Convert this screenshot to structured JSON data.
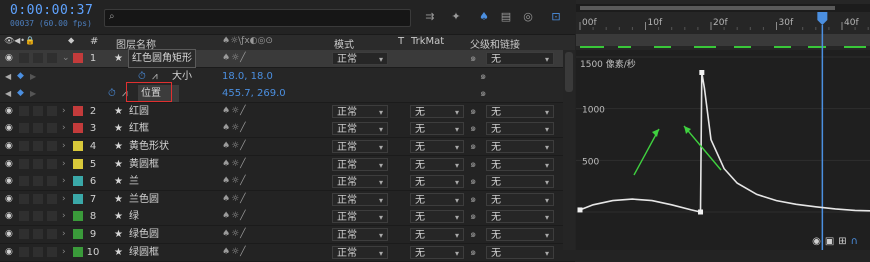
{
  "header": {
    "timecode": "0:00:00:37",
    "framecode": "00037 (60.00 fps)",
    "search_placeholder": "",
    "search_icon": "search-icon"
  },
  "columns": {
    "layer_name": "图层名称",
    "mode": "模式",
    "t": "T",
    "trkmat": "TrkMat",
    "parent": "父级和链接"
  },
  "layers": [
    {
      "num": "1",
      "name": "红色圆角矩形",
      "color": "#c33b3b",
      "mode": "正常",
      "trkmat": "",
      "parent": "无",
      "expanded": true,
      "selected": true
    },
    {
      "num": "2",
      "name": "红圆",
      "color": "#c33b3b",
      "mode": "正常",
      "trkmat": "无",
      "parent": "无"
    },
    {
      "num": "3",
      "name": "红框",
      "color": "#c33b3b",
      "mode": "正常",
      "trkmat": "无",
      "parent": "无"
    },
    {
      "num": "4",
      "name": "黄色形状",
      "color": "#d9c93a",
      "mode": "正常",
      "trkmat": "无",
      "parent": "无"
    },
    {
      "num": "5",
      "name": "黄圆框",
      "color": "#d9c93a",
      "mode": "正常",
      "trkmat": "无",
      "parent": "无"
    },
    {
      "num": "6",
      "name": "兰",
      "color": "#3aa8a8",
      "mode": "正常",
      "trkmat": "无",
      "parent": "无"
    },
    {
      "num": "7",
      "name": "兰色圆",
      "color": "#3aa8a8",
      "mode": "正常",
      "trkmat": "无",
      "parent": "无"
    },
    {
      "num": "8",
      "name": "绿",
      "color": "#3a9a3a",
      "mode": "正常",
      "trkmat": "无",
      "parent": "无"
    },
    {
      "num": "9",
      "name": "绿色圆",
      "color": "#3a9a3a",
      "mode": "正常",
      "trkmat": "无",
      "parent": "无"
    },
    {
      "num": "10",
      "name": "绿圆框",
      "color": "#3a9a3a",
      "mode": "正常",
      "trkmat": "无",
      "parent": "无"
    }
  ],
  "properties": [
    {
      "name": "大小",
      "value": "18.0, 18.0"
    },
    {
      "name": "位置",
      "value": "455.7, 269.0"
    }
  ],
  "ruler": {
    "ticks": [
      "00f",
      "10f",
      "20f",
      "30f",
      "40f"
    ],
    "playhead_frame": 37
  },
  "graph": {
    "unit_label": "1500 像素/秒",
    "y_ticks": [
      "1000",
      "500"
    ],
    "colors": {
      "curve": "#e6e6e6",
      "arrow": "#3fd13f",
      "highlight_box": "#e03030",
      "playhead": "#4b8fe0"
    }
  },
  "chart_data": {
    "type": "line",
    "title": "",
    "xlabel": "",
    "ylabel": "像素/秒",
    "xlim": [
      0,
      45
    ],
    "ylim": [
      0,
      1500
    ],
    "series": [
      {
        "x": [
          0,
          2,
          5,
          8,
          11,
          14,
          17,
          18.4,
          18.6,
          19,
          20,
          22,
          24,
          27,
          30,
          33,
          36,
          39,
          42,
          45
        ],
        "y": [
          20,
          70,
          110,
          125,
          110,
          70,
          20,
          0,
          1350,
          1200,
          700,
          420,
          280,
          170,
          110,
          75,
          50,
          30,
          15,
          10
        ]
      }
    ]
  }
}
